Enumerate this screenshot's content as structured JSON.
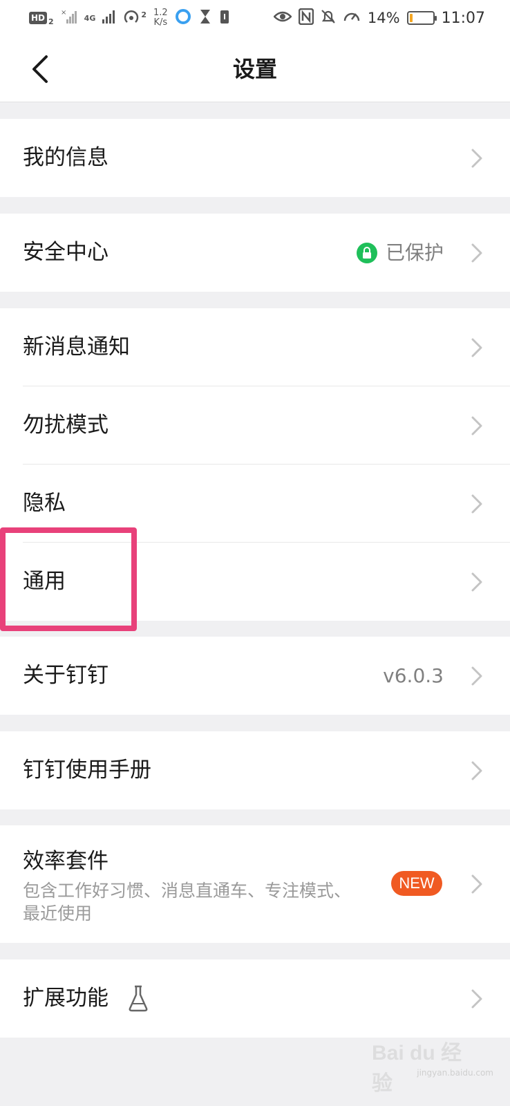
{
  "status_bar": {
    "hd": "HD",
    "hd_sub": "2",
    "net": "4G",
    "hotspot_num": "2",
    "speed_value": "1.2",
    "speed_unit": "K/s",
    "battery_percent": "14%",
    "battery_level": 0.14,
    "time": "11:07"
  },
  "header": {
    "title": "设置"
  },
  "groups": {
    "g1": {
      "my_info": "我的信息"
    },
    "g2": {
      "security": "安全中心",
      "security_status": "已保护",
      "security_color": "#1fbf5a"
    },
    "g3": {
      "notifications": "新消息通知",
      "dnd": "勿扰模式",
      "privacy": "隐私",
      "general": "通用"
    },
    "g4": {
      "about": "关于钉钉",
      "version": "v6.0.3"
    },
    "g5": {
      "manual": "钉钉使用手册"
    },
    "g6": {
      "suite": "效率套件",
      "suite_desc": "包含工作好习惯、消息直通车、专注模式、最近使用",
      "new_badge": "NEW",
      "badge_color": "#f05a22"
    },
    "g7": {
      "extensions": "扩展功能"
    }
  },
  "highlight_color": "#e8417a",
  "watermark": {
    "main": "Bai du 经验",
    "sub": "jingyan.baidu.com"
  }
}
